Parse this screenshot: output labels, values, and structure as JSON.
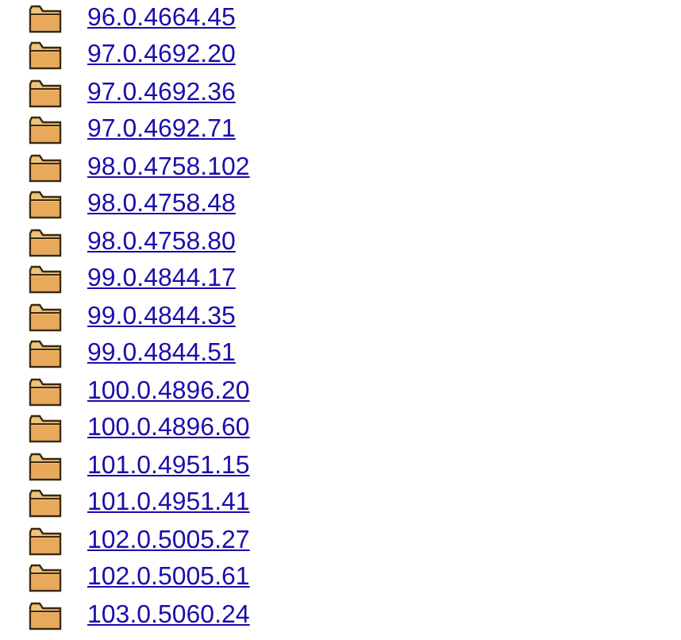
{
  "folders": [
    {
      "name": "96.0.4664.45"
    },
    {
      "name": "97.0.4692.20"
    },
    {
      "name": "97.0.4692.36"
    },
    {
      "name": "97.0.4692.71"
    },
    {
      "name": "98.0.4758.102"
    },
    {
      "name": "98.0.4758.48"
    },
    {
      "name": "98.0.4758.80"
    },
    {
      "name": "99.0.4844.17"
    },
    {
      "name": "99.0.4844.35"
    },
    {
      "name": "99.0.4844.51"
    },
    {
      "name": "100.0.4896.20"
    },
    {
      "name": "100.0.4896.60"
    },
    {
      "name": "101.0.4951.15"
    },
    {
      "name": "101.0.4951.41"
    },
    {
      "name": "102.0.5005.27"
    },
    {
      "name": "102.0.5005.61"
    },
    {
      "name": "103.0.5060.24"
    }
  ]
}
